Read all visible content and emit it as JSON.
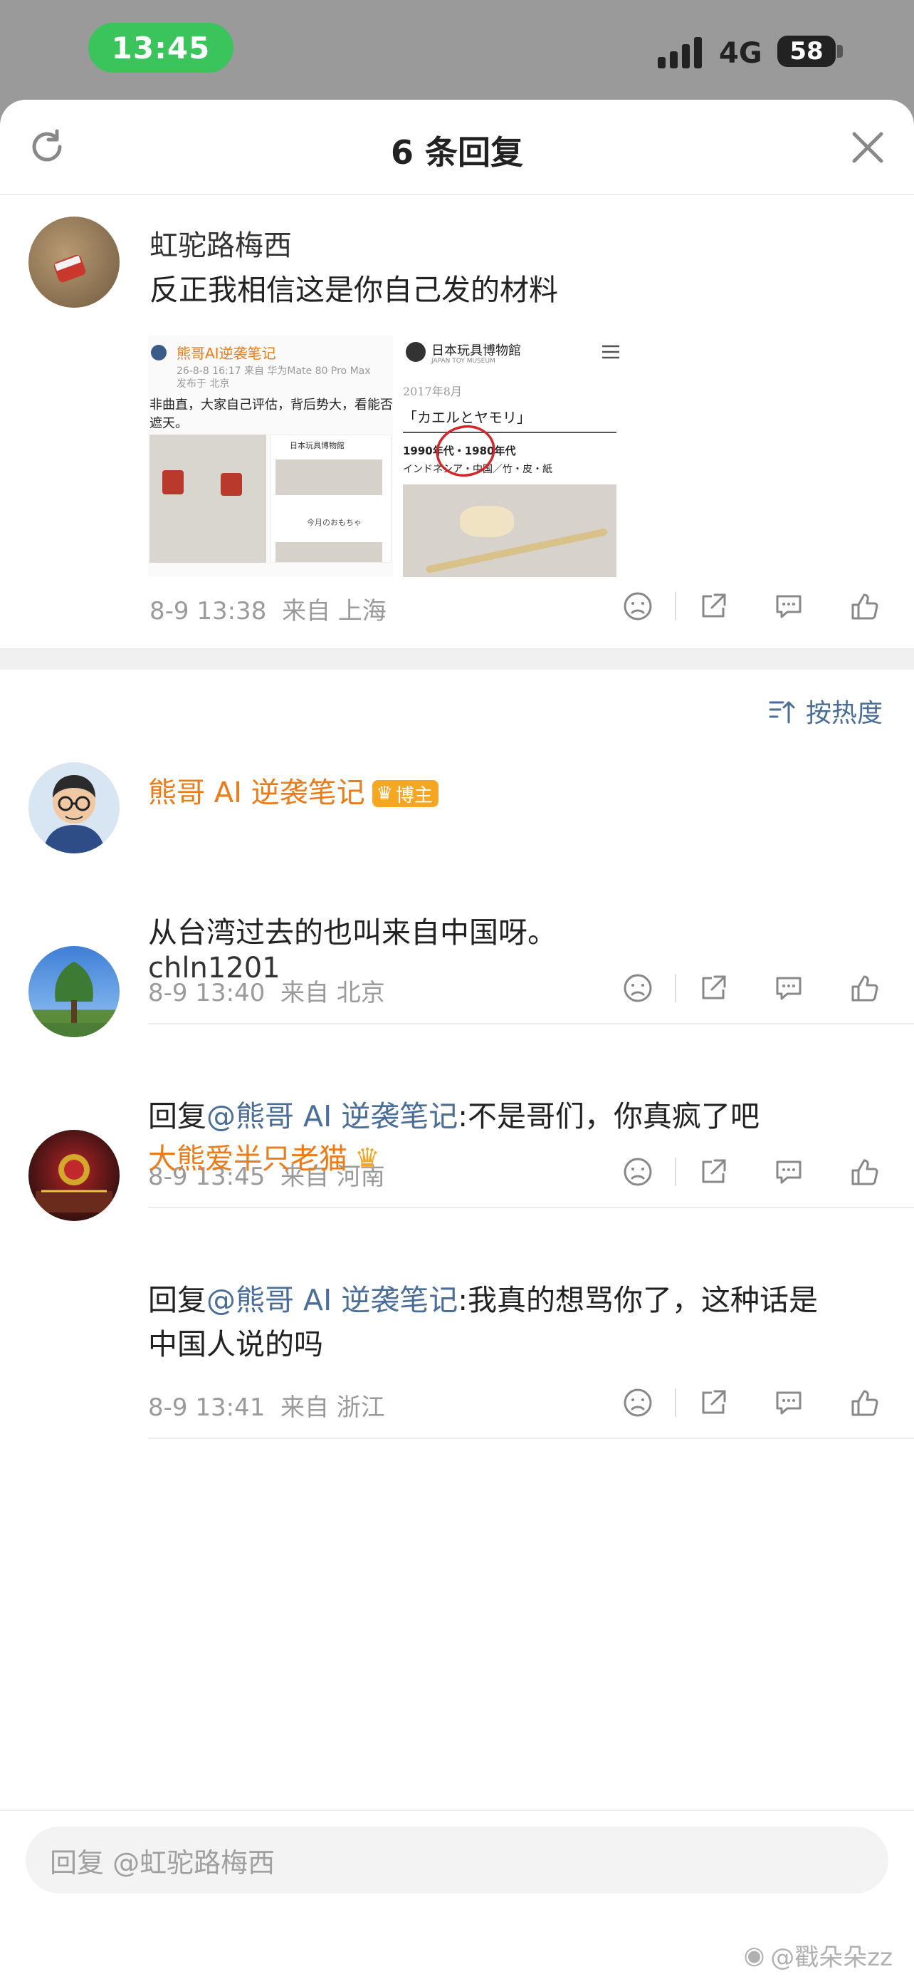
{
  "status_bar": {
    "time": "13:45",
    "network": "4G",
    "battery": "58"
  },
  "sheet": {
    "title": "6 条回复",
    "refresh_icon": "refresh-icon",
    "close_icon": "close-icon"
  },
  "root_comment": {
    "user": "虹驼路梅西",
    "text": "反正我相信这是你自己发的材料",
    "time": "8-9 13:38",
    "location": "来自 上海",
    "image1": {
      "account": "熊哥AI逆袭笔记",
      "post_meta": "26-8-8 16:17 来自 华为Mate 80 Pro Max",
      "posted_from": "发布于 北京",
      "body_line1": "非曲直，大家自己评估，背后势大，看能否",
      "body_line2": "遮天。",
      "small_museum": "日本玩具博物館",
      "small_caption": "今月のおもちゃ"
    },
    "image2": {
      "museum_name": "日本玩具博物館",
      "museum_sub": "JAPAN TOY MUSEUM",
      "date": "2017年8月",
      "toy_title": "「カエルとヤモリ」",
      "era": "1990年代・1980年代",
      "origin": "インドネシア・中国／竹・皮・紙"
    }
  },
  "sort": {
    "label": "按热度"
  },
  "replies": [
    {
      "user": "熊哥 AI 逆袭笔记",
      "badge": "博主",
      "text": "从台湾过去的也叫来自中国呀。",
      "time": "8-9 13:40",
      "location": "来自 北京"
    },
    {
      "user": "chln1201",
      "reply_prefix": "回复",
      "mention": "@熊哥 AI 逆袭笔记",
      "text": ":不是哥们，你真疯了吧",
      "time": "8-9 13:45",
      "location": "来自 河南"
    },
    {
      "user": "大熊爱半只老猫",
      "reply_prefix": "回复",
      "mention": "@熊哥 AI 逆袭笔记",
      "text_line1": ":我真的想骂你了，这种话是",
      "text_line2": "中国人说的吗",
      "time": "8-9 13:41",
      "location": "来自 浙江"
    }
  ],
  "reply_input": {
    "placeholder": "回复 @虹驼路梅西"
  },
  "watermark": "@戳朵朵zz",
  "colors": {
    "accent_blue": "#4b6e99",
    "vip_orange": "#ec7b18",
    "status_green": "#3bc35c"
  }
}
